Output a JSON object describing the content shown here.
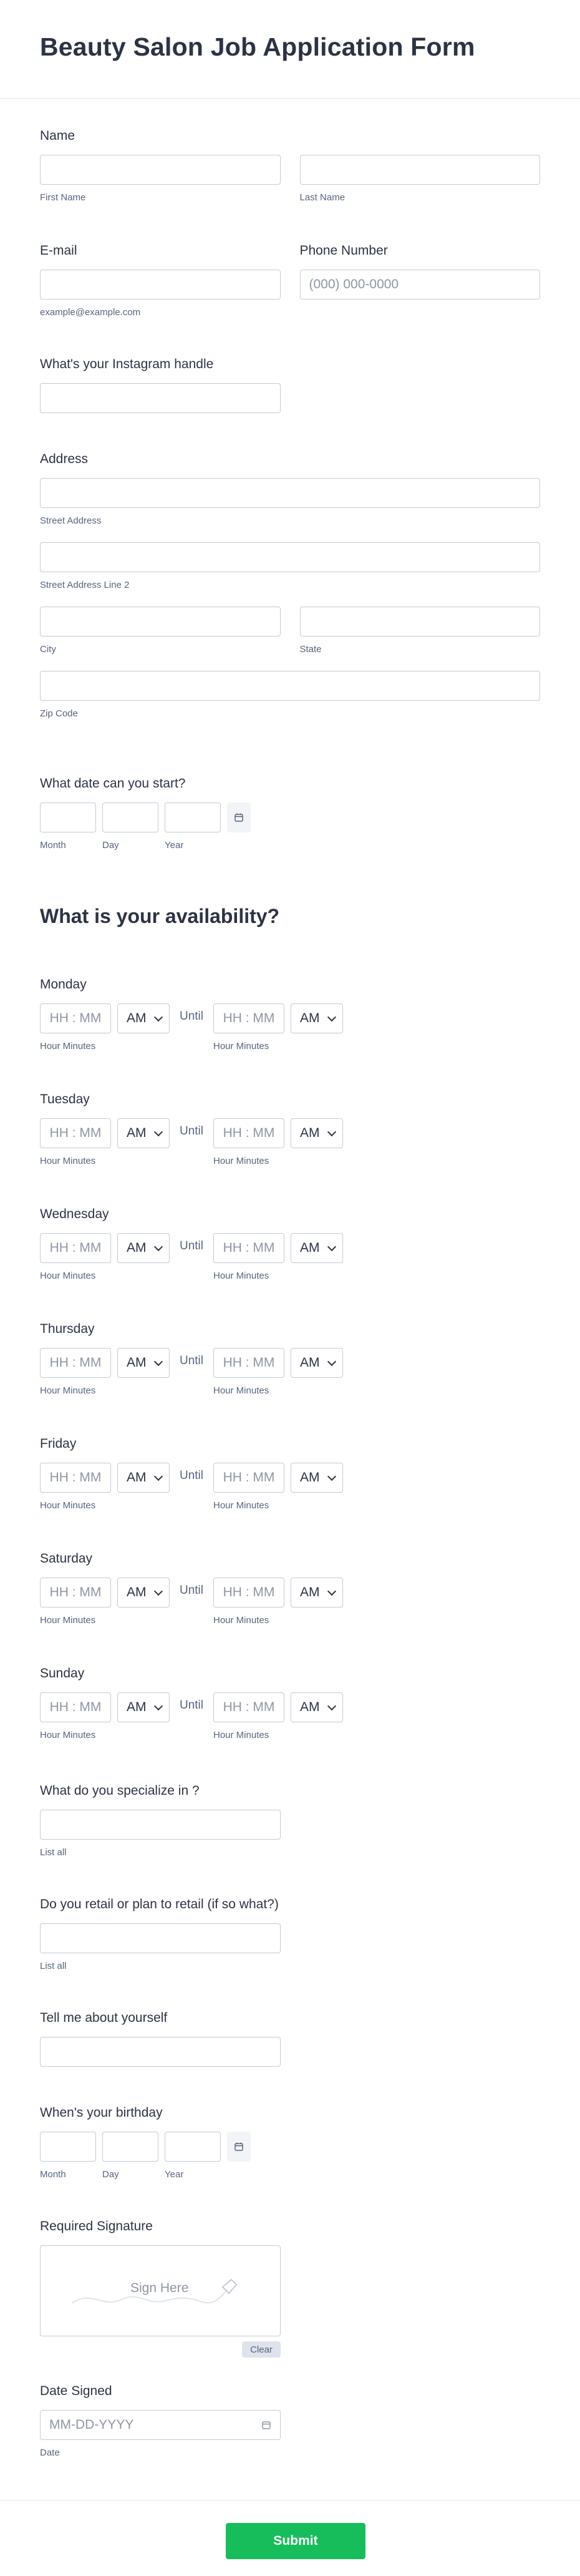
{
  "form": {
    "title": "Beauty Salon Job Application Form"
  },
  "name": {
    "label": "Name",
    "first_sub": "First Name",
    "last_sub": "Last Name"
  },
  "email": {
    "label": "E-mail",
    "sub": "example@example.com"
  },
  "phone": {
    "label": "Phone Number",
    "placeholder": "(000) 000-0000"
  },
  "instagram": {
    "label": "What's your Instagram handle"
  },
  "address": {
    "label": "Address",
    "street_sub": "Street Address",
    "street2_sub": "Street Address Line 2",
    "city_sub": "City",
    "state_sub": "State",
    "zip_sub": "Zip Code"
  },
  "start_date": {
    "label": "What date can you start?",
    "month_sub": "Month",
    "day_sub": "Day",
    "year_sub": "Year"
  },
  "availability": {
    "title": "What is your availability?",
    "placeholder": "HH : MM",
    "ampm": "AM",
    "until": "Until",
    "sub": "Hour Minutes",
    "days": [
      "Monday",
      "Tuesday",
      "Wednesday",
      "Thursday",
      "Friday",
      "Saturday",
      "Sunday"
    ]
  },
  "specialize": {
    "label": "What do you specialize in ?",
    "sub": "List all"
  },
  "retail": {
    "label": "Do you retail or plan to retail (if so what?)",
    "sub": "List all"
  },
  "about": {
    "label": "Tell me about yourself"
  },
  "birthday": {
    "label": "When's your birthday",
    "month_sub": "Month",
    "day_sub": "Day",
    "year_sub": "Year"
  },
  "signature": {
    "label": "Required Signature",
    "placeholder": "Sign Here",
    "clear": "Clear"
  },
  "date_signed": {
    "label": "Date Signed",
    "placeholder": "MM-DD-YYYY",
    "sub": "Date"
  },
  "submit": {
    "label": "Submit"
  }
}
